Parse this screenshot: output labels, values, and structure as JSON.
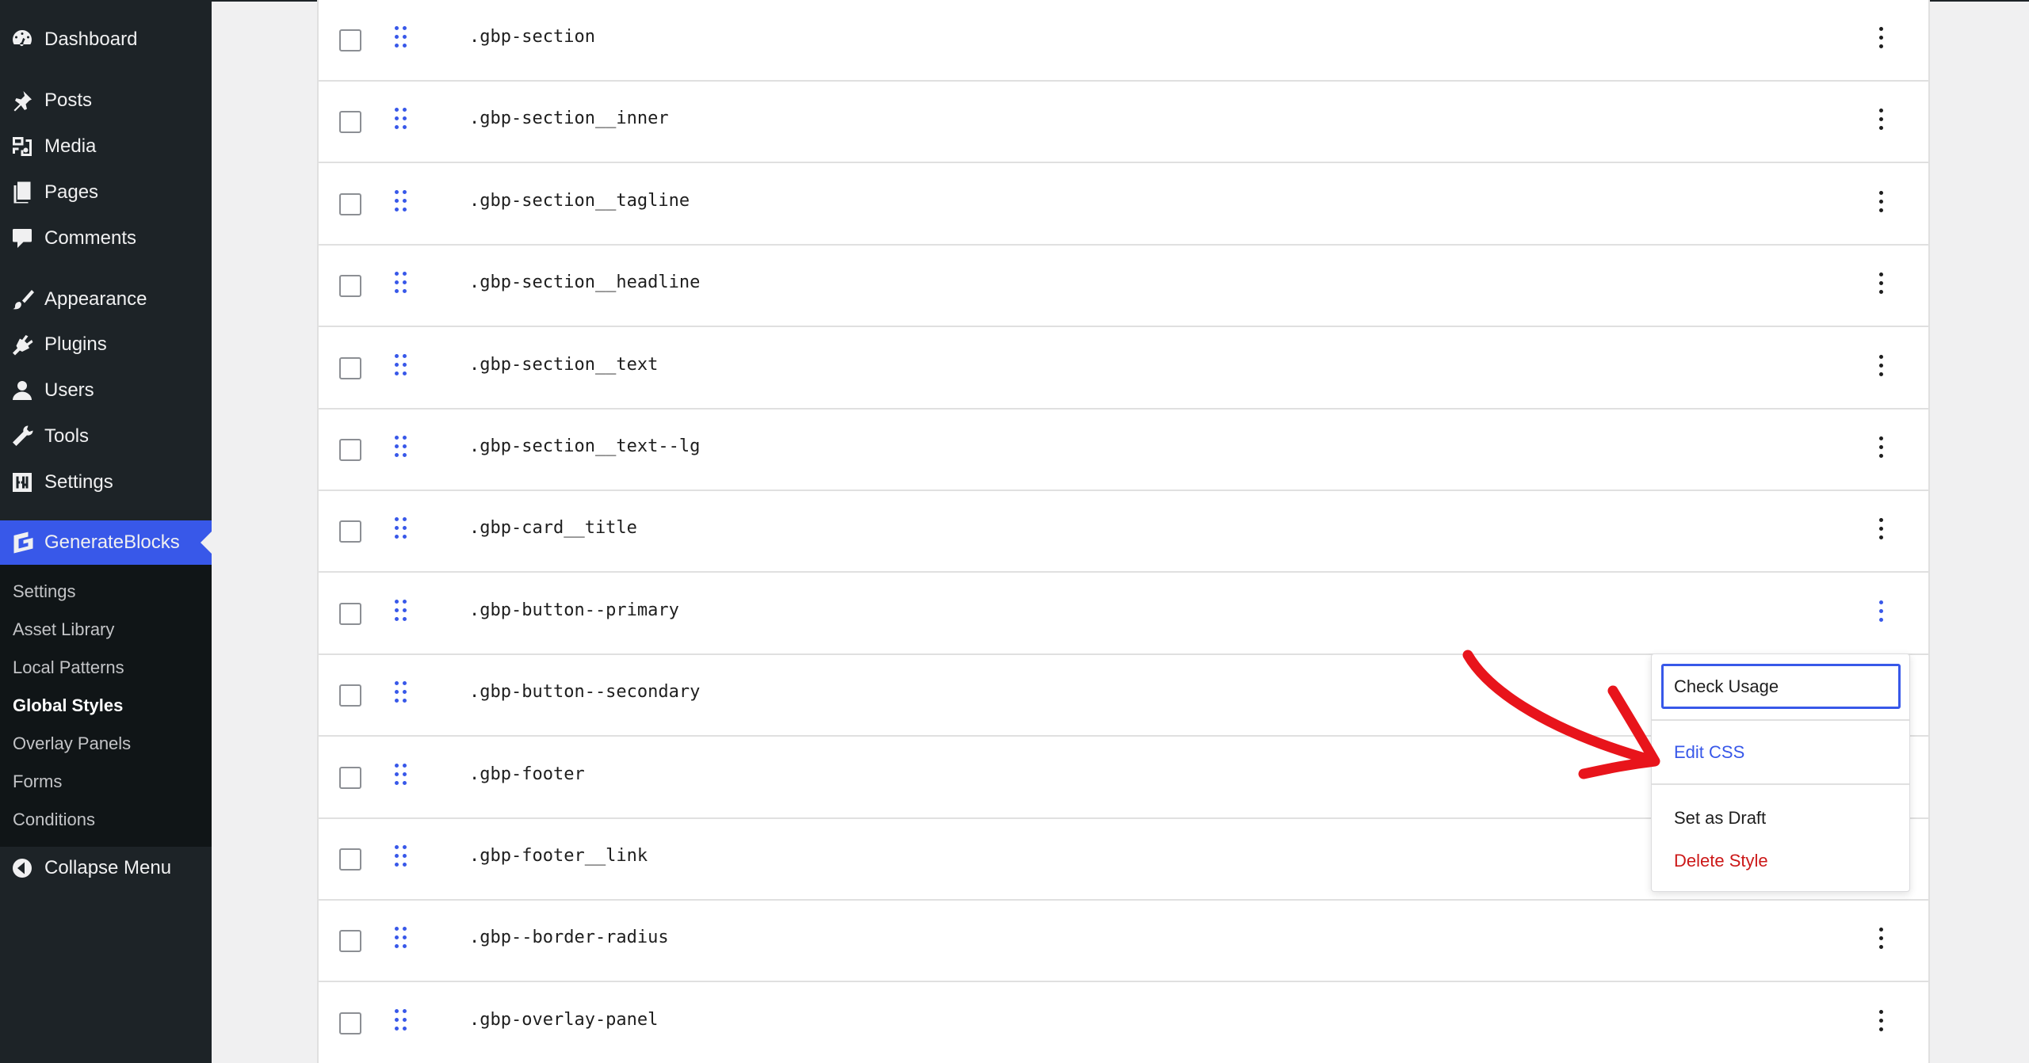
{
  "sidebar": {
    "menu": [
      {
        "label": "Dashboard",
        "icon": "dashboard-icon"
      },
      {
        "label": "Posts",
        "icon": "pin-icon"
      },
      {
        "label": "Media",
        "icon": "media-icon"
      },
      {
        "label": "Pages",
        "icon": "pages-icon"
      },
      {
        "label": "Comments",
        "icon": "comment-icon"
      },
      {
        "label": "Appearance",
        "icon": "brush-icon"
      },
      {
        "label": "Plugins",
        "icon": "plug-icon"
      },
      {
        "label": "Users",
        "icon": "user-icon"
      },
      {
        "label": "Tools",
        "icon": "wrench-icon"
      },
      {
        "label": "Settings",
        "icon": "sliders-icon"
      }
    ],
    "active_plugin": {
      "label": "GenerateBlocks",
      "icon": "generateblocks-icon"
    },
    "submenu": [
      "Settings",
      "Asset Library",
      "Local Patterns",
      "Global Styles",
      "Overlay Panels",
      "Forms",
      "Conditions"
    ],
    "current_submenu": "Global Styles",
    "collapse_label": "Collapse Menu"
  },
  "styles_table": {
    "rows": [
      ".gbp-section",
      ".gbp-section__inner",
      ".gbp-section__tagline",
      ".gbp-section__headline",
      ".gbp-section__text",
      ".gbp-section__text--lg",
      ".gbp-card__title",
      ".gbp-button--primary",
      ".gbp-button--secondary",
      ".gbp-footer",
      ".gbp-footer__link",
      ".gbp--border-radius",
      ".gbp-overlay-panel"
    ]
  },
  "dropdown": {
    "check_usage": "Check Usage",
    "edit_css": "Edit CSS",
    "set_as_draft": "Set as Draft",
    "delete_style": "Delete Style"
  },
  "colors": {
    "accent": "#3858e9",
    "danger": "#cc1818",
    "annotation_arrow": "#e8141b",
    "sidebar_bg": "#1d2327"
  }
}
